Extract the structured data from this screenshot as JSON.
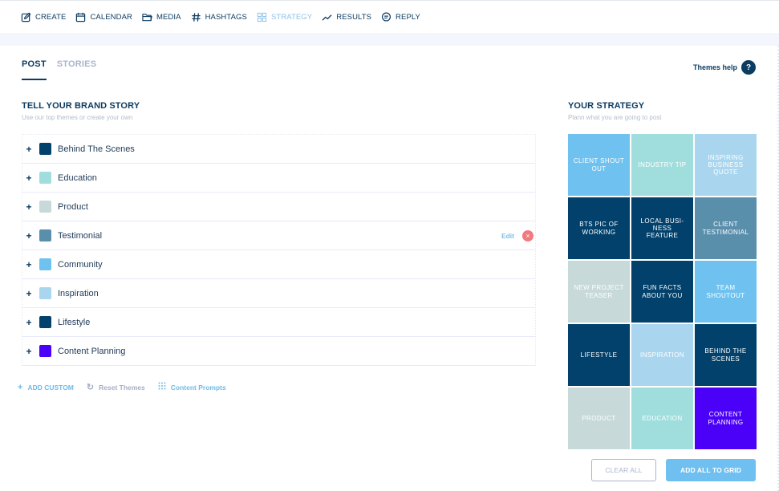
{
  "nav": {
    "items": [
      {
        "label": "CREATE",
        "icon": "edit-icon",
        "active": false
      },
      {
        "label": "CALENDAR",
        "icon": "calendar-icon",
        "active": false
      },
      {
        "label": "MEDIA",
        "icon": "folder-icon",
        "active": false
      },
      {
        "label": "HASHTAGS",
        "icon": "hashtag-icon",
        "active": false
      },
      {
        "label": "STRATEGY",
        "icon": "grid-icon",
        "active": true
      },
      {
        "label": "RESULTS",
        "icon": "trend-icon",
        "active": false
      },
      {
        "label": "REPLY",
        "icon": "chat-icon",
        "active": false
      }
    ]
  },
  "tabs": [
    {
      "label": "POST",
      "active": true
    },
    {
      "label": "STORIES",
      "active": false
    }
  ],
  "themes_help": {
    "label": "Themes help",
    "icon": "?"
  },
  "brand_story": {
    "title": "TELL YOUR BRAND STORY",
    "subtitle": "Use our top themes or create your own",
    "edit_label": "Edit",
    "remove_icon": "×",
    "themes": [
      {
        "name": "Behind The Scenes",
        "color": "#02416b"
      },
      {
        "name": "Education",
        "color": "#a0dede"
      },
      {
        "name": "Product",
        "color": "#c8d9da"
      },
      {
        "name": "Testimonial",
        "color": "#5a8fac",
        "hovered": true
      },
      {
        "name": "Community",
        "color": "#6fc2f0"
      },
      {
        "name": "Inspiration",
        "color": "#a9d6ee"
      },
      {
        "name": "Lifestyle",
        "color": "#02416b"
      },
      {
        "name": "Content Planning",
        "color": "#4b00f8"
      }
    ],
    "actions": {
      "add_custom": "ADD CUSTOM",
      "reset_themes": "Reset Themes",
      "content_prompts": "Content Prompts"
    }
  },
  "strategy": {
    "title": "YOUR STRATEGY",
    "subtitle": "Plann what you are going to post",
    "tiles": [
      {
        "label": "CLIENT SHOUT OUT",
        "color": "#6fc2f0"
      },
      {
        "label": "INDUSTRY TIP",
        "color": "#a0dede"
      },
      {
        "label": "INSPIRING BUSINESS QUOTE",
        "color": "#a9d6ee"
      },
      {
        "label": "BTS PIC OF WORKING",
        "color": "#02416b"
      },
      {
        "label": "LOCAL BUSI-NESS FEATURE",
        "color": "#02416b"
      },
      {
        "label": "CLIENT TESTIMONIAL",
        "color": "#5a8fac"
      },
      {
        "label": "NEW PROJECT TEASER",
        "color": "#c8d9da"
      },
      {
        "label": "FUN FACTS ABOUT YOU",
        "color": "#02416b"
      },
      {
        "label": "TEAM SHOUTOUT",
        "color": "#6fc2f0"
      },
      {
        "label": "LIFESTYLE",
        "color": "#02416b"
      },
      {
        "label": "INSPIRATION",
        "color": "#a9d6ee"
      },
      {
        "label": "BEHIND THE SCENES",
        "color": "#02416b"
      },
      {
        "label": "PRODUCT",
        "color": "#c8d9da"
      },
      {
        "label": "EDUCATION",
        "color": "#a0dede"
      },
      {
        "label": "CONTENT PLANNING",
        "color": "#4b00f8"
      }
    ],
    "clear_all": "CLEAR ALL",
    "add_all": "ADD ALL TO GRID"
  }
}
